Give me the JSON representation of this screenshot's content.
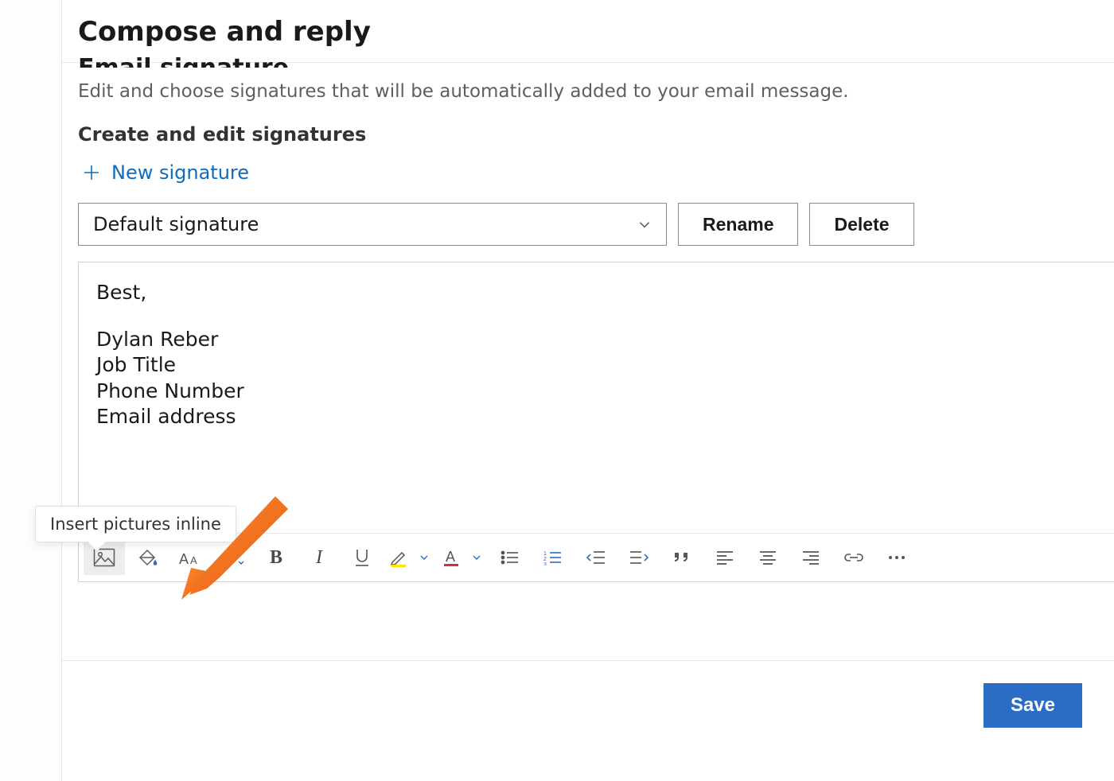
{
  "header": {
    "title": "Compose and reply"
  },
  "section": {
    "heading_cut": "Email signature",
    "description": "Edit and choose signatures that will be automatically added to your email message.",
    "subheading": "Create and edit signatures",
    "new_signature": "New signature"
  },
  "selector": {
    "value": "Default signature"
  },
  "buttons": {
    "rename": "Rename",
    "delete": "Delete",
    "save": "Save"
  },
  "editor": {
    "line1": "Best,",
    "line2": "Dylan Reber",
    "line3": "Job Title",
    "line4": "Phone Number",
    "line5": "Email address"
  },
  "tooltip": {
    "insert_pictures": "Insert pictures inline"
  }
}
